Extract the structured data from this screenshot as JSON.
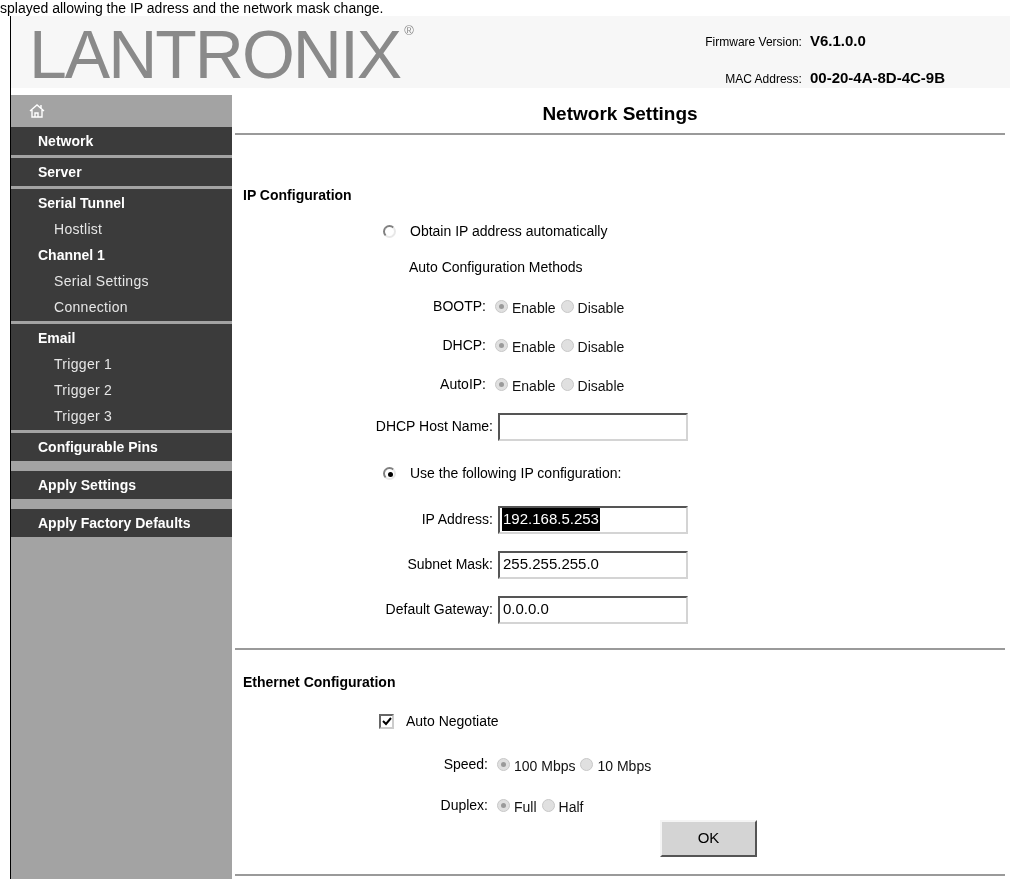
{
  "caption": "splayed allowing the IP adress and the network mask change.",
  "header": {
    "logo": "LANTRONIX",
    "logo_mark": "®",
    "firmware_label": "Firmware Version:",
    "firmware_value": "V6.1.0.0",
    "mac_label": "MAC Address:",
    "mac_value": "00-20-4A-8D-4C-9B"
  },
  "sidebar": {
    "groups": [
      [
        {
          "label": "Network",
          "kind": "main"
        }
      ],
      [
        {
          "label": "Server",
          "kind": "main"
        }
      ],
      [
        {
          "label": "Serial Tunnel",
          "kind": "main"
        },
        {
          "label": "Hostlist",
          "kind": "sub"
        },
        {
          "label": "Channel 1",
          "kind": "main"
        },
        {
          "label": "Serial Settings",
          "kind": "sub"
        },
        {
          "label": "Connection",
          "kind": "sub"
        }
      ],
      [
        {
          "label": "Email",
          "kind": "main"
        },
        {
          "label": "Trigger 1",
          "kind": "sub"
        },
        {
          "label": "Trigger 2",
          "kind": "sub"
        },
        {
          "label": "Trigger 3",
          "kind": "sub"
        }
      ],
      [
        {
          "label": "Configurable Pins",
          "kind": "main"
        }
      ],
      [
        {
          "label": "Apply Settings",
          "kind": "action"
        }
      ],
      [
        {
          "label": "Apply Factory Defaults",
          "kind": "action"
        }
      ]
    ]
  },
  "title": "Network Settings",
  "ip_configuration": {
    "heading": "IP Configuration",
    "obtain_auto": {
      "label": "Obtain IP address automatically",
      "selected": false
    },
    "methods_label": "Auto Configuration Methods",
    "methods": [
      {
        "label": "BOOTP:",
        "disabled": true,
        "options": [
          {
            "label": "Enable",
            "selected": true
          },
          {
            "label": "Disable",
            "selected": false
          }
        ]
      },
      {
        "label": "DHCP:",
        "disabled": true,
        "options": [
          {
            "label": "Enable",
            "selected": true
          },
          {
            "label": "Disable",
            "selected": false
          }
        ]
      },
      {
        "label": "AutoIP:",
        "disabled": true,
        "options": [
          {
            "label": "Enable",
            "selected": true
          },
          {
            "label": "Disable",
            "selected": false
          }
        ]
      }
    ],
    "host_name": {
      "label": "DHCP Host Name:"
    },
    "use_following": {
      "label": "Use the following IP configuration:",
      "selected": true
    },
    "fields": [
      {
        "label": "IP Address:",
        "value": "192.168.5.253",
        "text_selected": true
      },
      {
        "label": "Subnet Mask:",
        "value": "255.255.255.0",
        "text_selected": false
      },
      {
        "label": "Default Gateway:",
        "value": "0.0.0.0",
        "text_selected": false
      }
    ]
  },
  "ethernet": {
    "heading": "Ethernet Configuration",
    "auto_negotiate": {
      "label": "Auto Negotiate",
      "checked": true
    },
    "rows": [
      {
        "label": "Speed:",
        "disabled": true,
        "options": [
          {
            "label": "100 Mbps",
            "selected": true
          },
          {
            "label": "10 Mbps",
            "selected": false
          }
        ]
      },
      {
        "label": "Duplex:",
        "disabled": true,
        "options": [
          {
            "label": "Full",
            "selected": true
          },
          {
            "label": "Half",
            "selected": false
          }
        ]
      }
    ],
    "ok": "OK"
  }
}
